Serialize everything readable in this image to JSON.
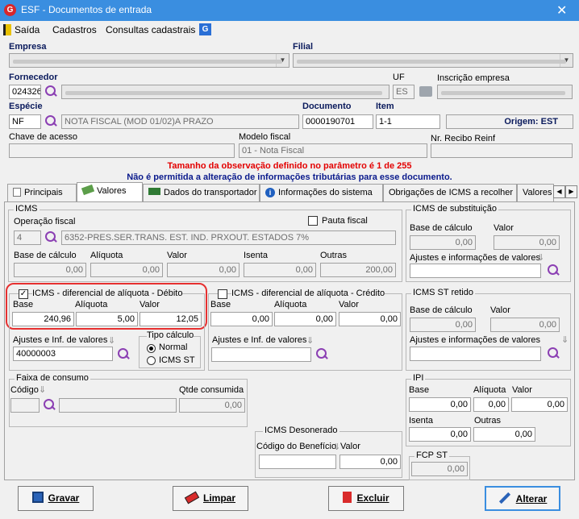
{
  "window": {
    "title": "ESF - Documentos de entrada"
  },
  "menu": [
    "Saída",
    "Cadastros",
    "Consultas cadastrais"
  ],
  "header": {
    "empresa_label": "Empresa",
    "filial_label": "Filial",
    "fornecedor_label": "Fornecedor",
    "fornecedor_code": "024326",
    "uf_label": "UF",
    "uf_value": "ES",
    "inscricao_label": "Inscrição empresa",
    "especie_label": "Espécie",
    "especie_code": "NF",
    "especie_desc": "NOTA FISCAL (MOD 01/02)A PRAZO",
    "documento_label": "Documento",
    "documento_value": "0000190701",
    "item_label": "Item",
    "item_value": "1-1",
    "origem": "Origem: EST",
    "chave_label": "Chave de acesso",
    "modelo_label": "Modelo fiscal",
    "modelo_value": "01 - Nota Fiscal",
    "recibo_label": "Nr. Recibo Reinf"
  },
  "messages": {
    "warn1": "Tamanho da observação definido no parâmetro é 1 de 255",
    "warn2": "Não é permitida a alteração de informações tributárias para esse documento."
  },
  "tabs": [
    "Principais",
    "Valores",
    "Dados do transportador",
    "Informações do sistema",
    "Obrigações de ICMS a recolher",
    "Valores"
  ],
  "icms": {
    "title": "ICMS",
    "op_label": "Operação fiscal",
    "op_code": "4",
    "op_desc": "6352-PRES.SER.TRANS. EST. IND. PRXOUT. ESTADOS 7%",
    "pauta_label": "Pauta fiscal",
    "base_label": "Base de cálculo",
    "base_value": "0,00",
    "aliq_label": "Alíquota",
    "aliq_value": "0,00",
    "valor_label": "Valor",
    "valor_value": "0,00",
    "isenta_label": "Isenta",
    "isenta_value": "0,00",
    "outras_label": "Outras",
    "outras_value": "200,00"
  },
  "difal_debito": {
    "title": "ICMS - diferencial de alíquota - Débito",
    "check": "✓",
    "base_label": "Base",
    "base_value": "240,96",
    "aliq_label": "Alíquota",
    "aliq_value": "5,00",
    "valor_label": "Valor",
    "valor_value": "12,05",
    "ajustes_label": "Ajustes e Inf. de valores",
    "ajustes_value": "40000003",
    "tipo_label": "Tipo cálculo",
    "tipo_normal": "Normal",
    "tipo_st": "ICMS ST"
  },
  "difal_credito": {
    "title": "ICMS - diferencial de alíquota - Crédito",
    "base_label": "Base",
    "base_value": "0,00",
    "aliq_label": "Alíquota",
    "aliq_value": "0,00",
    "valor_label": "Valor",
    "valor_value": "0,00",
    "ajustes_label": "Ajustes e Inf. de valores"
  },
  "icms_sub": {
    "title": "ICMS de substituição",
    "base_label": "Base de cálculo",
    "base_value": "0,00",
    "valor_label": "Valor",
    "valor_value": "0,00",
    "ajustes_label": "Ajustes e informações de valores"
  },
  "icms_st_ret": {
    "title": "ICMS ST retido",
    "base_label": "Base de cálculo",
    "base_value": "0,00",
    "valor_label": "Valor",
    "valor_value": "0,00",
    "ajustes_label": "Ajustes e informações de valores"
  },
  "faixa": {
    "title": "Faixa de consumo",
    "codigo_label": "Código",
    "qtde_label": "Qtde consumida",
    "qtde_value": "0,00"
  },
  "desonerado": {
    "title": "ICMS Desonerado",
    "cod_label": "Código do Benefício",
    "valor_label": "Valor",
    "valor_value": "0,00"
  },
  "ipi": {
    "title": "IPI",
    "base_label": "Base",
    "base_value": "0,00",
    "aliq_label": "Alíquota",
    "aliq_value": "0,00",
    "valor_label": "Valor",
    "valor_value": "0,00",
    "isenta_label": "Isenta",
    "isenta_value": "0,00",
    "outras_label": "Outras",
    "outras_value": "0,00"
  },
  "fcp": {
    "title": "FCP ST",
    "value": "0,00"
  },
  "buttons": {
    "gravar": "Gravar",
    "limpar": "Limpar",
    "excluir": "Excluir",
    "alterar": "Alterar"
  }
}
